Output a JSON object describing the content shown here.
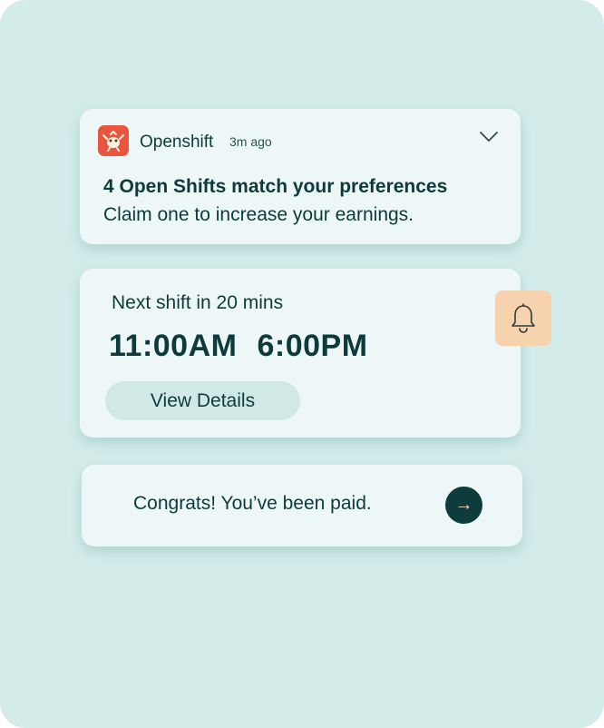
{
  "notification": {
    "app_name": "Openshift",
    "time_ago": "3m ago",
    "title": "4 Open Shifts match your preferences",
    "body": "Claim one to increase your earnings.",
    "logo_icon": "openshift-logo-icon",
    "expand_icon": "chevron-down-icon"
  },
  "shift": {
    "heading": "Next shift in 20 mins",
    "start_time": "11:00AM",
    "end_time": "6:00PM",
    "button_label": "View Details",
    "bell_icon": "bell-icon"
  },
  "payment": {
    "message": "Congrats! You’ve been paid.",
    "arrow_glyph": "→",
    "arrow_icon": "arrow-right-icon"
  },
  "colors": {
    "background": "#d3ecea",
    "card": "#edf7f7",
    "text_dark": "#0d3a3a",
    "logo_red": "#e9563d",
    "bell_peach": "#f6d2ae",
    "button_teal": "#d0e9e7",
    "arrow_dark": "#0e3b3b"
  }
}
